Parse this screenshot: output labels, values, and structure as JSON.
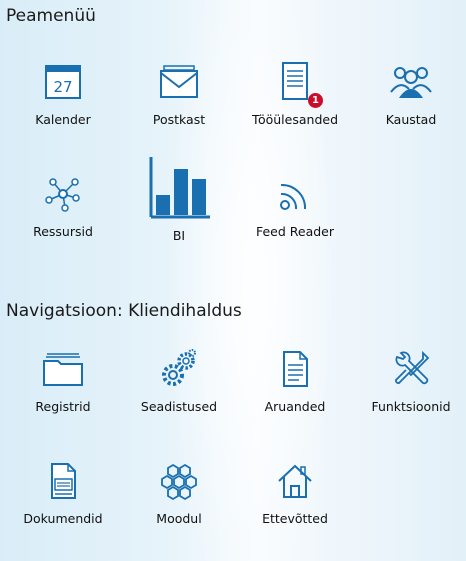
{
  "sections": [
    {
      "title": "Peamenüü",
      "items": [
        {
          "label": "Kalender",
          "icon": "calendar-icon",
          "icon_text": "27"
        },
        {
          "label": "Postkast",
          "icon": "mail-icon"
        },
        {
          "label": "Tööülesanded",
          "icon": "tasks-icon",
          "badge": "1"
        },
        {
          "label": "Kaustad",
          "icon": "groups-icon"
        },
        {
          "label": "Ressursid",
          "icon": "network-icon"
        },
        {
          "label": "BI",
          "icon": "bar-chart-icon"
        },
        {
          "label": "Feed Reader",
          "icon": "rss-icon"
        }
      ]
    },
    {
      "title": "Navigatsioon: Kliendihaldus",
      "items": [
        {
          "label": "Registrid",
          "icon": "folder-icon"
        },
        {
          "label": "Seadistused",
          "icon": "gears-icon"
        },
        {
          "label": "Aruanded",
          "icon": "report-icon"
        },
        {
          "label": "Funktsioonid",
          "icon": "tools-icon"
        },
        {
          "label": "Dokumendid",
          "icon": "document-icon"
        },
        {
          "label": "Moodul",
          "icon": "modules-icon"
        },
        {
          "label": "Ettevõtted",
          "icon": "home-icon"
        }
      ]
    }
  ],
  "colors": {
    "icon": "#1a6fb0",
    "badge": "#c8102e"
  }
}
